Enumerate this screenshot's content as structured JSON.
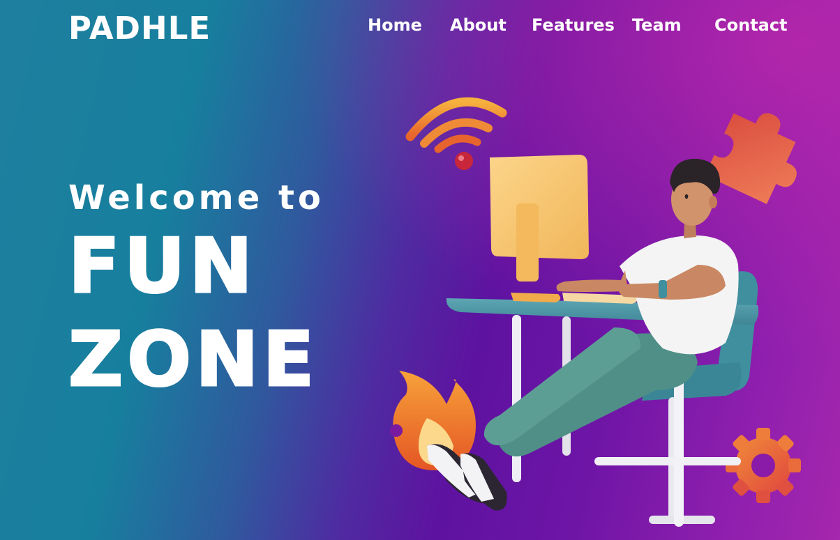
{
  "header": {
    "logo": "PADHLE",
    "nav": [
      {
        "label": "Home"
      },
      {
        "label": "About"
      },
      {
        "label": "Features"
      },
      {
        "label": "Team"
      },
      {
        "label": "Contact"
      }
    ]
  },
  "hero": {
    "welcome": "Welcome to",
    "line1": "FUN",
    "line2": "ZONE"
  },
  "colors": {
    "gradient_left": "#177f9e",
    "gradient_mid": "#5e12a0",
    "gradient_right": "#a527ad",
    "text": "#ffffff"
  },
  "illustration": {
    "icons": [
      "wifi-icon",
      "puzzle-icon",
      "fire-icon",
      "gear-icon",
      "computer-icon",
      "person-at-desk"
    ]
  }
}
